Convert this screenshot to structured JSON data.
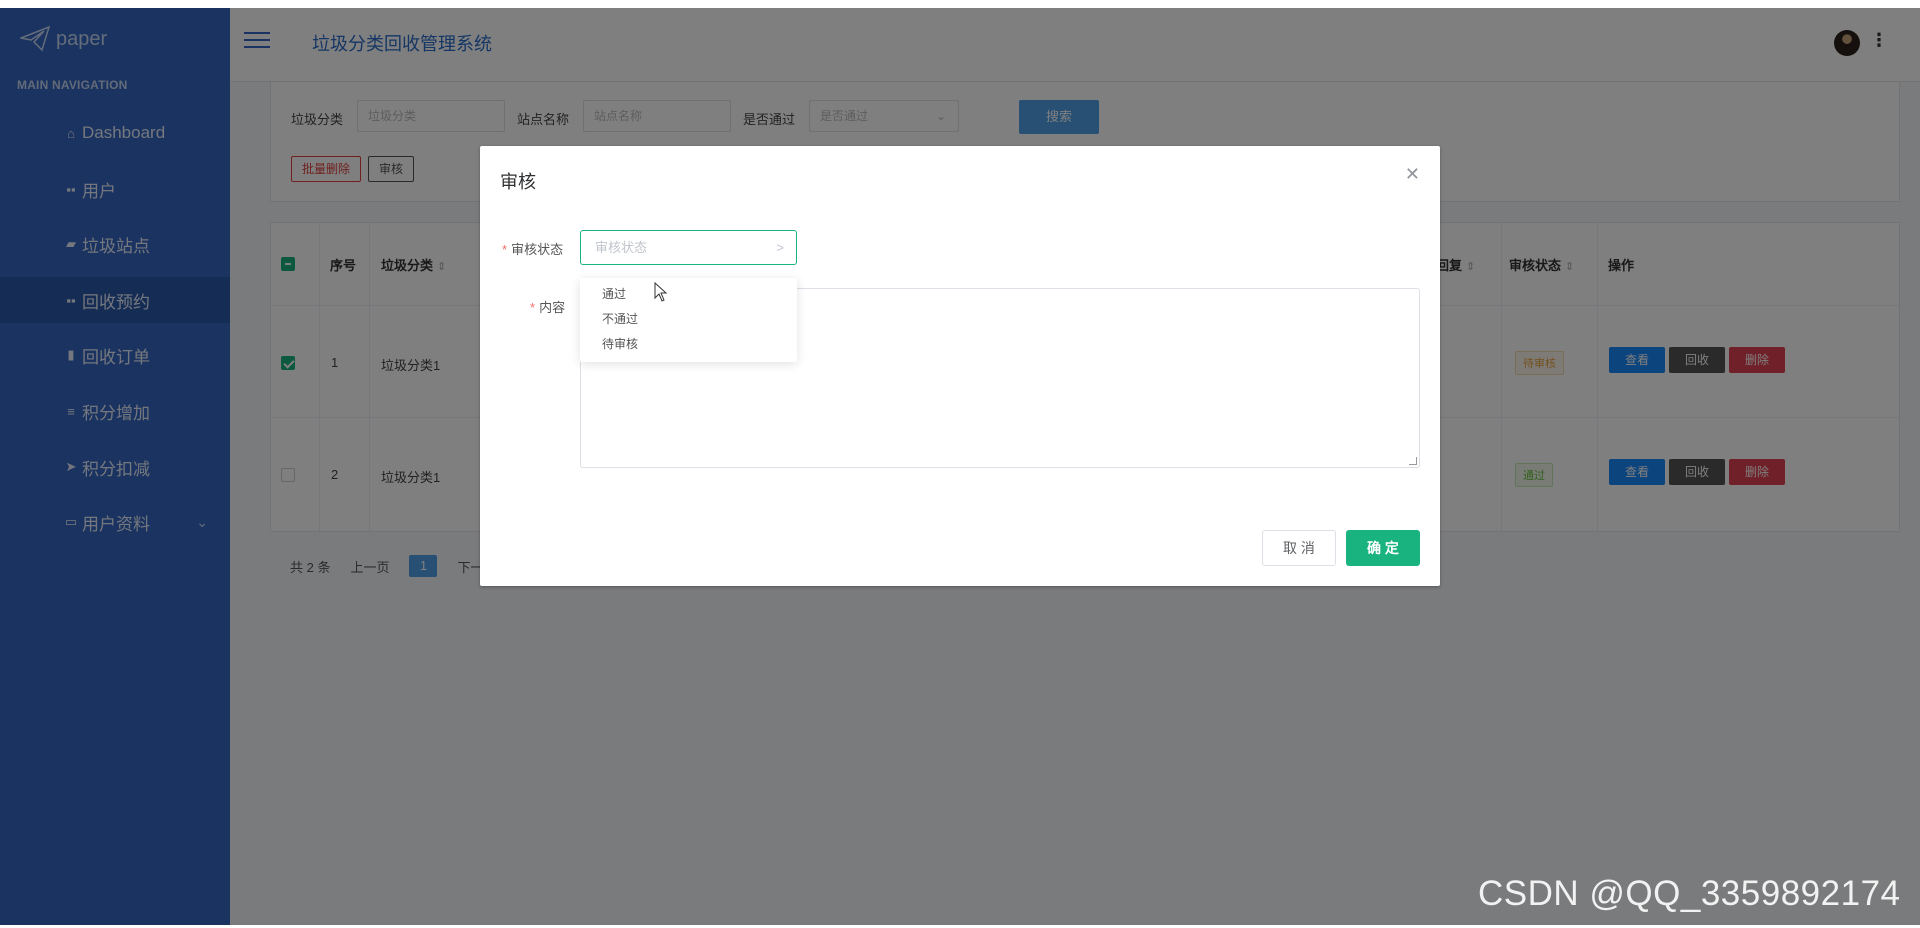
{
  "brand": {
    "name": "paper"
  },
  "sidebar": {
    "header": "MAIN NAVIGATION",
    "items": [
      {
        "label": "Dashboard",
        "icon": "home-icon"
      },
      {
        "label": "用户",
        "icon": "grid-icon"
      },
      {
        "label": "垃圾站点",
        "icon": "ticket-icon"
      },
      {
        "label": "回收预约",
        "icon": "grid-icon",
        "active": true
      },
      {
        "label": "回收订单",
        "icon": "bar-chart-icon"
      },
      {
        "label": "积分增加",
        "icon": "sliders-icon"
      },
      {
        "label": "积分扣减",
        "icon": "send-icon"
      },
      {
        "label": "用户资料",
        "icon": "calendar-icon",
        "expandable": true
      }
    ]
  },
  "header": {
    "title": "垃圾分类回收管理系统",
    "menu_icon": "hamburger-icon",
    "more_icon": "more-vertical-icon"
  },
  "filters": {
    "fields": [
      {
        "label": "垃圾分类",
        "placeholder": "垃圾分类"
      },
      {
        "label": "站点名称",
        "placeholder": "站点名称"
      },
      {
        "label": "是否通过",
        "placeholder": "是否通过"
      }
    ],
    "search_button": "搜索",
    "batch_delete_button": "批量删除",
    "review_button": "审核"
  },
  "table": {
    "columns": [
      "序号",
      "垃圾分类",
      "回复",
      "审核状态",
      "操作"
    ],
    "rows": [
      {
        "index": "1",
        "category": "垃圾分类1",
        "status": "待审核",
        "selected": true
      },
      {
        "index": "2",
        "category": "垃圾分类1",
        "status": "通过",
        "selected": false
      }
    ],
    "actions": [
      "查看",
      "回收",
      "删除"
    ]
  },
  "pagination": {
    "total": "共 2 条",
    "prev": "上一页",
    "current": "1",
    "next": "下一"
  },
  "dialog": {
    "title": "审核",
    "status_label": "审核状态",
    "status_placeholder": "审核状态",
    "content_label": "内容",
    "options": [
      "通过",
      "不通过",
      "待审核"
    ],
    "cancel": "取 消",
    "confirm": "确 定"
  },
  "watermark": "CSDN @QQ_3359892174",
  "colors": {
    "sidebar": "#3466c2",
    "accent": "#19b37f",
    "primary": "#1989fa",
    "danger": "#e04050"
  }
}
